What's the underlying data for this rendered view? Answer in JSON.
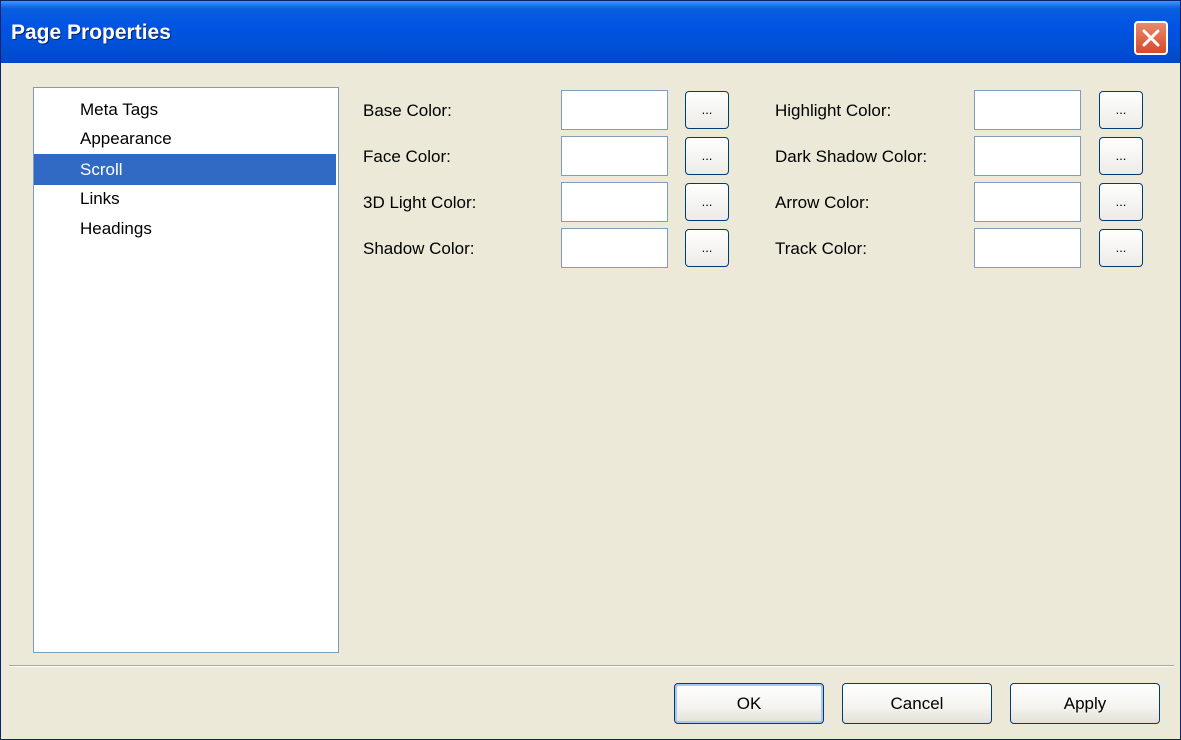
{
  "window": {
    "title": "Page Properties",
    "close_icon": "close-icon"
  },
  "sidebar": {
    "items": [
      {
        "label": "Meta Tags",
        "selected": false
      },
      {
        "label": "Appearance",
        "selected": false
      },
      {
        "label": "Scroll",
        "selected": true
      },
      {
        "label": "Links",
        "selected": false
      },
      {
        "label": "Headings",
        "selected": false
      }
    ]
  },
  "fields": {
    "left": [
      {
        "label": "Base Color:",
        "value": "",
        "button": "..."
      },
      {
        "label": "Face Color:",
        "value": "",
        "button": "..."
      },
      {
        "label": "3D Light Color:",
        "value": "",
        "button": "..."
      },
      {
        "label": "Shadow Color:",
        "value": "",
        "button": "..."
      }
    ],
    "right": [
      {
        "label": "Highlight Color:",
        "value": "",
        "button": "..."
      },
      {
        "label": "Dark Shadow Color:",
        "value": "",
        "button": "..."
      },
      {
        "label": "Arrow Color:",
        "value": "",
        "button": "..."
      },
      {
        "label": "Track Color:",
        "value": "",
        "button": "..."
      }
    ]
  },
  "buttons": {
    "ok": "OK",
    "cancel": "Cancel",
    "apply": "Apply"
  },
  "colors": {
    "titlebar": "#0054e3",
    "selection": "#316ac5",
    "dialog_bg": "#ece9d8",
    "close": "#d9482a"
  }
}
